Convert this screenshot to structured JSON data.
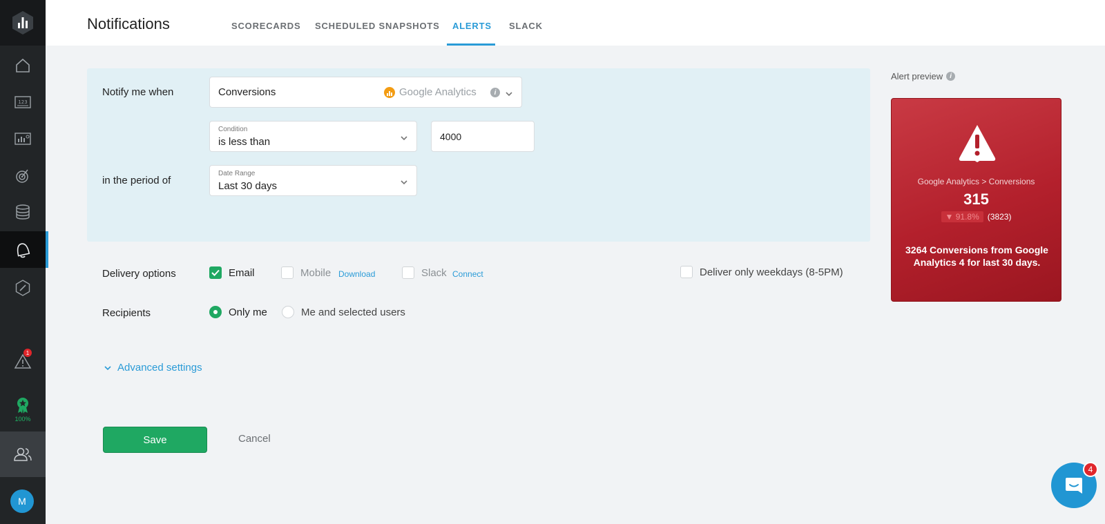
{
  "header": {
    "title": "Notifications",
    "tabs": [
      {
        "label": "SCORECARDS",
        "active": false
      },
      {
        "label": "SCHEDULED SNAPSHOTS",
        "active": false
      },
      {
        "label": "ALERTS",
        "active": true
      },
      {
        "label": "SLACK",
        "active": false
      }
    ]
  },
  "sidebar": {
    "items": [
      {
        "icon": "home-icon"
      },
      {
        "icon": "metrics-123-icon"
      },
      {
        "icon": "dashboard-icon"
      },
      {
        "icon": "goals-icon"
      },
      {
        "icon": "datasets-icon"
      },
      {
        "icon": "bell-icon",
        "active": true
      },
      {
        "icon": "compass-icon"
      }
    ],
    "alerts_badge": "1",
    "progress_label": "100%",
    "avatar_initial": "M"
  },
  "form": {
    "notify_label": "Notify me when",
    "metric": {
      "value": "Conversions",
      "source": "Google Analytics"
    },
    "condition": {
      "label": "Condition",
      "value": "is less than"
    },
    "threshold": "4000",
    "period_label": "in the period of",
    "date_range": {
      "label": "Date Range",
      "value": "Last 30 days"
    },
    "delivery_label": "Delivery options",
    "delivery": {
      "email": {
        "label": "Email",
        "checked": true
      },
      "mobile": {
        "label": "Mobile",
        "link": "Download",
        "checked": false
      },
      "slack": {
        "label": "Slack",
        "link": "Connect",
        "checked": false
      },
      "weekdays": {
        "label": "Deliver only weekdays (8-5PM)",
        "checked": false
      }
    },
    "recipients_label": "Recipients",
    "recipients": {
      "only_me": {
        "label": "Only me",
        "selected": true
      },
      "selected_users": {
        "label": "Me and selected users",
        "selected": false
      }
    },
    "advanced_label": "Advanced settings",
    "save_label": "Save",
    "cancel_label": "Cancel"
  },
  "preview": {
    "label": "Alert preview",
    "path": "Google Analytics > Conversions",
    "value": "315",
    "change_pct": "▼ 91.8%",
    "previous": "(3823)",
    "message": "3264 Conversions from Google Analytics 4 for last 30 days."
  },
  "chat": {
    "badge": "4"
  },
  "colors": {
    "accent": "#2a9bd7",
    "success": "#1fa862",
    "alert_red": "#b3202c",
    "sidebar": "#222527"
  }
}
